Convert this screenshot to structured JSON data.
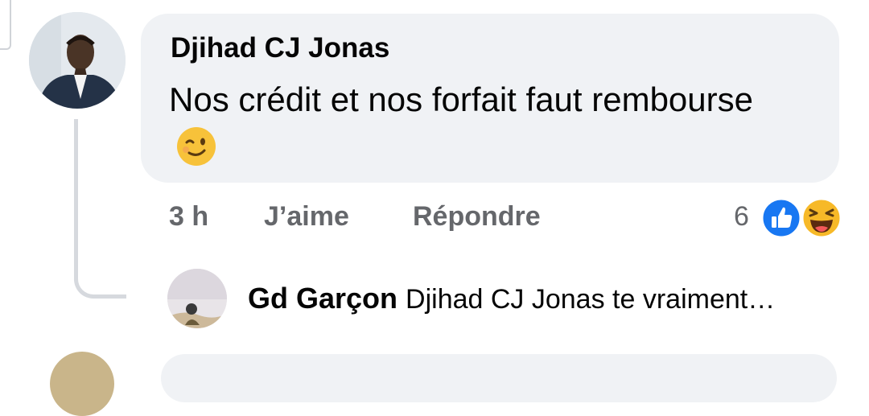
{
  "comment": {
    "author": "Djihad CJ Jonas",
    "text": "Nos crédit et nos forfait faut rembourse",
    "emoji_icon": "winking-face-icon",
    "time": "3 h",
    "like_label": "J’aime",
    "reply_label": "Répondre",
    "reaction_count": "6",
    "reactions": [
      "like-reaction-icon",
      "haha-reaction-icon"
    ]
  },
  "reply": {
    "author": "Gd Garçon",
    "text": "Djihad CJ Jonas te vraiment…"
  },
  "colors": {
    "bubble": "#f0f2f5",
    "meta_text": "#65676b",
    "like_blue": "#1877f2",
    "haha_yellow": "#f7b928"
  }
}
